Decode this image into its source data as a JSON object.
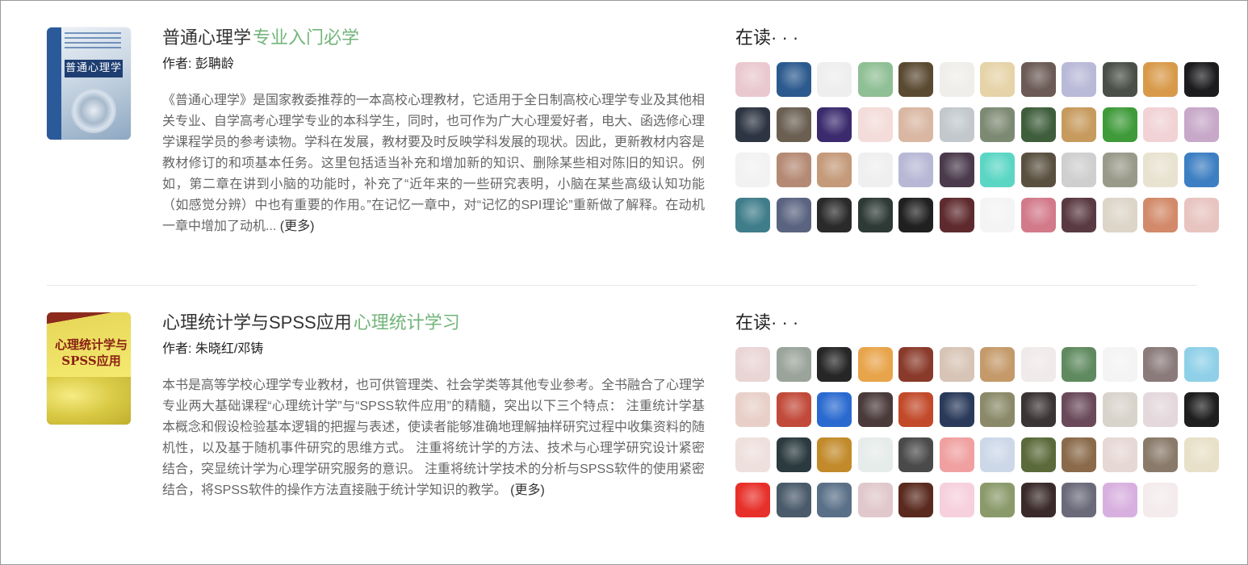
{
  "books": [
    {
      "cover_title": "普通心理学",
      "title": "普通心理学",
      "tag": "专业入门必学",
      "author": "作者: 彭聃龄",
      "description": "《普通心理学》是国家教委推荐的一本高校心理教材，它适用于全日制高校心理学专业及其他相关专业、自学高考心理学专业的本科学生，同时，也可作为广大心理爱好者，电大、函选修心理学课程学员的参考读物。学科在发展，教材要及时反映学科发展的现状。因此，更新教材内容是教材修订的和项基本任务。这里包括适当补充和增加新的知识、删除某些相对陈旧的知识。例如，第二章在讲到小脑的功能时，补充了“近年来的一些研究表明，小脑在某些高级认知功能（如感觉分辨）中也有重要的作用。”在记忆一章中，对“记忆的SPI理论”重新做了解释。在动机一章中增加了动机...",
      "more": "(更多)",
      "readers_title": "在读· · ·",
      "avatar_colors": [
        "#e9c9cf",
        "#2c5a8e",
        "#eeeeee",
        "#8fbf94",
        "#5a4a32",
        "#f0eeea",
        "#e6d3a8",
        "#6b5a55",
        "#b9b9d8",
        "#4a4f48",
        "#d89a4a",
        "#1c1c1e",
        "#2d3542",
        "#6b5f52",
        "#3b2b6e",
        "#f3dcd9",
        "#d9b7a2",
        "#c2c8cc",
        "#7d8a73",
        "#3f5e3c",
        "#c79a5e",
        "#3f9b3a",
        "#f1d2d5",
        "#c7a8c8",
        "#f2f2f2",
        "#b58a74",
        "#c49a7a",
        "#efefef",
        "#b8b8d6",
        "#4a3a4c",
        "#5bd6c4",
        "#5a5040",
        "#cfcfcf",
        "#9a9a8a",
        "#e8e2d0",
        "#3d7fc2",
        "#3f7d8a",
        "#5a6480",
        "#2a2a2a",
        "#2e3a36",
        "#202020",
        "#5e2a2e",
        "#f4f4f4",
        "#d27a8a",
        "#5a3a42",
        "#ddd5c8",
        "#d28a6a",
        "#e8c4c0"
      ]
    },
    {
      "cover_title": "心理统计学与SPSS应用",
      "title": "心理统计学与SPSS应用",
      "tag": "心理统计学习",
      "author": "作者: 朱晓红/邓铸",
      "description": "本书是高等学校心理学专业教材，也可供管理类、社会学类等其他专业参考。全书融合了心理学专业两大基础课程“心理统计学”与“SPSS软件应用”的精髓，突出以下三个特点： 注重统计学基本概念和假设检验基本逻辑的把握与表述，使读者能够准确地理解抽样研究过程中收集资料的随机性，以及基于随机事件研究的思维方式。 注重将统计学的方法、技术与心理学研究设计紧密结合，突显统计学为心理学研究服务的意识。 注重将统计学技术的分析与SPSS软件的使用紧密结合，将SPSS软件的操作方法直接融于统计学知识的教学。",
      "more": "(更多)",
      "readers_title": "在读· · ·",
      "avatar_colors": [
        "#ead5d5",
        "#9aa49a",
        "#262626",
        "#e8a44a",
        "#8a3a2a",
        "#d7c4b6",
        "#c49a6a",
        "#f0eaea",
        "#5f8a5f",
        "#f4f4f4",
        "#8a7a7a",
        "#8fd0e8",
        "#e8d0c8",
        "#c24a3a",
        "#2a6ad0",
        "#4a3a3a",
        "#c24a2a",
        "#2a3a5a",
        "#8a8a6a",
        "#3a3434",
        "#6a4a5a",
        "#d8d4cc",
        "#e4d8dc",
        "#1e1e1e",
        "#eee0dc",
        "#2a3a3e",
        "#c28a2a",
        "#e6ecea",
        "#4a4a4a",
        "#f0a0a0",
        "#ccd8e8",
        "#5a6a3a",
        "#8a6a4a",
        "#e6d8d4",
        "#8a7a6a",
        "#e8e0c8",
        "#e8302a",
        "#4a5a6a",
        "#5a7088",
        "#e0c8cc",
        "#5a2a1e",
        "#f6d0dc",
        "#8a9a6a",
        "#3a2a2a",
        "#6a6a7a",
        "#d8b0e0",
        "#f4ecec"
      ]
    }
  ]
}
